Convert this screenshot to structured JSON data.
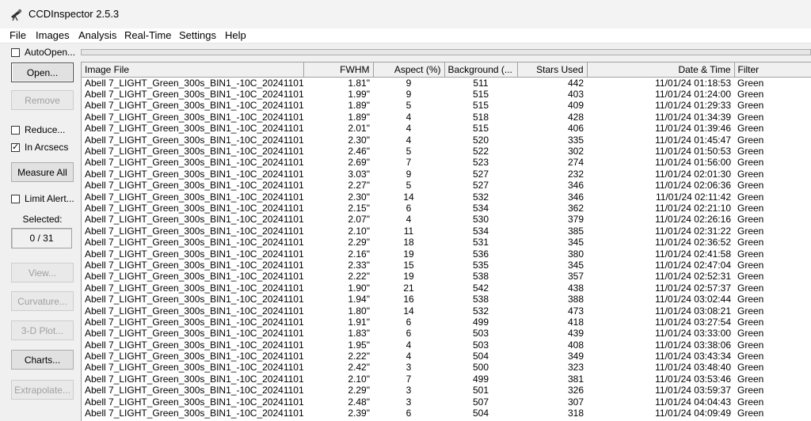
{
  "window": {
    "title": "CCDInspector 2.5.3"
  },
  "menu": [
    "File",
    "Images",
    "Analysis",
    "Real-Time",
    "Settings",
    "Help"
  ],
  "left_panel": {
    "autoopen_label": "AutoOpen...",
    "autoopen_checked": false,
    "open_button": "Open...",
    "remove_button": "Remove",
    "reduce_label": "Reduce...",
    "reduce_checked": false,
    "arcsecs_label": "In Arcsecs",
    "arcsecs_checked": true,
    "measure_all_button": "Measure All",
    "limit_alert_label": "Limit Alert...",
    "limit_alert_checked": false,
    "selected_label": "Selected:",
    "selected_count": "0 / 31",
    "view_button": "View...",
    "curvature_button": "Curvature...",
    "plot3d_button": "3-D Plot...",
    "charts_button": "Charts...",
    "extrapolate_button": "Extrapolate..."
  },
  "table": {
    "columns": [
      "Image File",
      "FWHM",
      "Aspect (%)",
      "Background (...",
      "Stars Used",
      "Date & Time",
      "Filter"
    ],
    "rows": [
      [
        "Abell 7_LIGHT_Green_300s_BIN1_-10C_20241101_...",
        "1.81\"",
        "9",
        "511",
        "442",
        "11/01/24 01:18:53",
        "Green"
      ],
      [
        "Abell 7_LIGHT_Green_300s_BIN1_-10C_20241101_...",
        "1.99\"",
        "9",
        "515",
        "403",
        "11/01/24 01:24:00",
        "Green"
      ],
      [
        "Abell 7_LIGHT_Green_300s_BIN1_-10C_20241101_...",
        "1.89\"",
        "5",
        "515",
        "409",
        "11/01/24 01:29:33",
        "Green"
      ],
      [
        "Abell 7_LIGHT_Green_300s_BIN1_-10C_20241101_...",
        "1.89\"",
        "4",
        "518",
        "428",
        "11/01/24 01:34:39",
        "Green"
      ],
      [
        "Abell 7_LIGHT_Green_300s_BIN1_-10C_20241101_...",
        "2.01\"",
        "4",
        "515",
        "406",
        "11/01/24 01:39:46",
        "Green"
      ],
      [
        "Abell 7_LIGHT_Green_300s_BIN1_-10C_20241101_...",
        "2.30\"",
        "4",
        "520",
        "335",
        "11/01/24 01:45:47",
        "Green"
      ],
      [
        "Abell 7_LIGHT_Green_300s_BIN1_-10C_20241101_...",
        "2.46\"",
        "5",
        "522",
        "302",
        "11/01/24 01:50:53",
        "Green"
      ],
      [
        "Abell 7_LIGHT_Green_300s_BIN1_-10C_20241101_...",
        "2.69\"",
        "7",
        "523",
        "274",
        "11/01/24 01:56:00",
        "Green"
      ],
      [
        "Abell 7_LIGHT_Green_300s_BIN1_-10C_20241101_...",
        "3.03\"",
        "9",
        "527",
        "232",
        "11/01/24 02:01:30",
        "Green"
      ],
      [
        "Abell 7_LIGHT_Green_300s_BIN1_-10C_20241101_...",
        "2.27\"",
        "5",
        "527",
        "346",
        "11/01/24 02:06:36",
        "Green"
      ],
      [
        "Abell 7_LIGHT_Green_300s_BIN1_-10C_20241101_...",
        "2.30\"",
        "14",
        "532",
        "346",
        "11/01/24 02:11:42",
        "Green"
      ],
      [
        "Abell 7_LIGHT_Green_300s_BIN1_-10C_20241101_...",
        "2.15\"",
        "6",
        "534",
        "362",
        "11/01/24 02:21:10",
        "Green"
      ],
      [
        "Abell 7_LIGHT_Green_300s_BIN1_-10C_20241101_...",
        "2.07\"",
        "4",
        "530",
        "379",
        "11/01/24 02:26:16",
        "Green"
      ],
      [
        "Abell 7_LIGHT_Green_300s_BIN1_-10C_20241101_...",
        "2.10\"",
        "11",
        "534",
        "385",
        "11/01/24 02:31:22",
        "Green"
      ],
      [
        "Abell 7_LIGHT_Green_300s_BIN1_-10C_20241101_...",
        "2.29\"",
        "18",
        "531",
        "345",
        "11/01/24 02:36:52",
        "Green"
      ],
      [
        "Abell 7_LIGHT_Green_300s_BIN1_-10C_20241101_...",
        "2.16\"",
        "19",
        "536",
        "380",
        "11/01/24 02:41:58",
        "Green"
      ],
      [
        "Abell 7_LIGHT_Green_300s_BIN1_-10C_20241101_...",
        "2.33\"",
        "15",
        "535",
        "345",
        "11/01/24 02:47:04",
        "Green"
      ],
      [
        "Abell 7_LIGHT_Green_300s_BIN1_-10C_20241101_...",
        "2.22\"",
        "19",
        "538",
        "357",
        "11/01/24 02:52:31",
        "Green"
      ],
      [
        "Abell 7_LIGHT_Green_300s_BIN1_-10C_20241101_...",
        "1.90\"",
        "21",
        "542",
        "438",
        "11/01/24 02:57:37",
        "Green"
      ],
      [
        "Abell 7_LIGHT_Green_300s_BIN1_-10C_20241101_...",
        "1.94\"",
        "16",
        "538",
        "388",
        "11/01/24 03:02:44",
        "Green"
      ],
      [
        "Abell 7_LIGHT_Green_300s_BIN1_-10C_20241101_...",
        "1.80\"",
        "14",
        "532",
        "473",
        "11/01/24 03:08:21",
        "Green"
      ],
      [
        "Abell 7_LIGHT_Green_300s_BIN1_-10C_20241101_...",
        "1.91\"",
        "6",
        "499",
        "418",
        "11/01/24 03:27:54",
        "Green"
      ],
      [
        "Abell 7_LIGHT_Green_300s_BIN1_-10C_20241101_...",
        "1.83\"",
        "6",
        "503",
        "439",
        "11/01/24 03:33:00",
        "Green"
      ],
      [
        "Abell 7_LIGHT_Green_300s_BIN1_-10C_20241101_...",
        "1.95\"",
        "4",
        "503",
        "408",
        "11/01/24 03:38:06",
        "Green"
      ],
      [
        "Abell 7_LIGHT_Green_300s_BIN1_-10C_20241101_...",
        "2.22\"",
        "4",
        "504",
        "349",
        "11/01/24 03:43:34",
        "Green"
      ],
      [
        "Abell 7_LIGHT_Green_300s_BIN1_-10C_20241101_...",
        "2.42\"",
        "3",
        "500",
        "323",
        "11/01/24 03:48:40",
        "Green"
      ],
      [
        "Abell 7_LIGHT_Green_300s_BIN1_-10C_20241101_...",
        "2.10\"",
        "7",
        "499",
        "381",
        "11/01/24 03:53:46",
        "Green"
      ],
      [
        "Abell 7_LIGHT_Green_300s_BIN1_-10C_20241101_...",
        "2.29\"",
        "3",
        "501",
        "326",
        "11/01/24 03:59:37",
        "Green"
      ],
      [
        "Abell 7_LIGHT_Green_300s_BIN1_-10C_20241101_...",
        "2.48\"",
        "3",
        "507",
        "307",
        "11/01/24 04:04:43",
        "Green"
      ],
      [
        "Abell 7_LIGHT_Green_300s_BIN1_-10C_20241101_...",
        "2.39\"",
        "6",
        "504",
        "318",
        "11/01/24 04:09:49",
        "Green"
      ]
    ]
  }
}
